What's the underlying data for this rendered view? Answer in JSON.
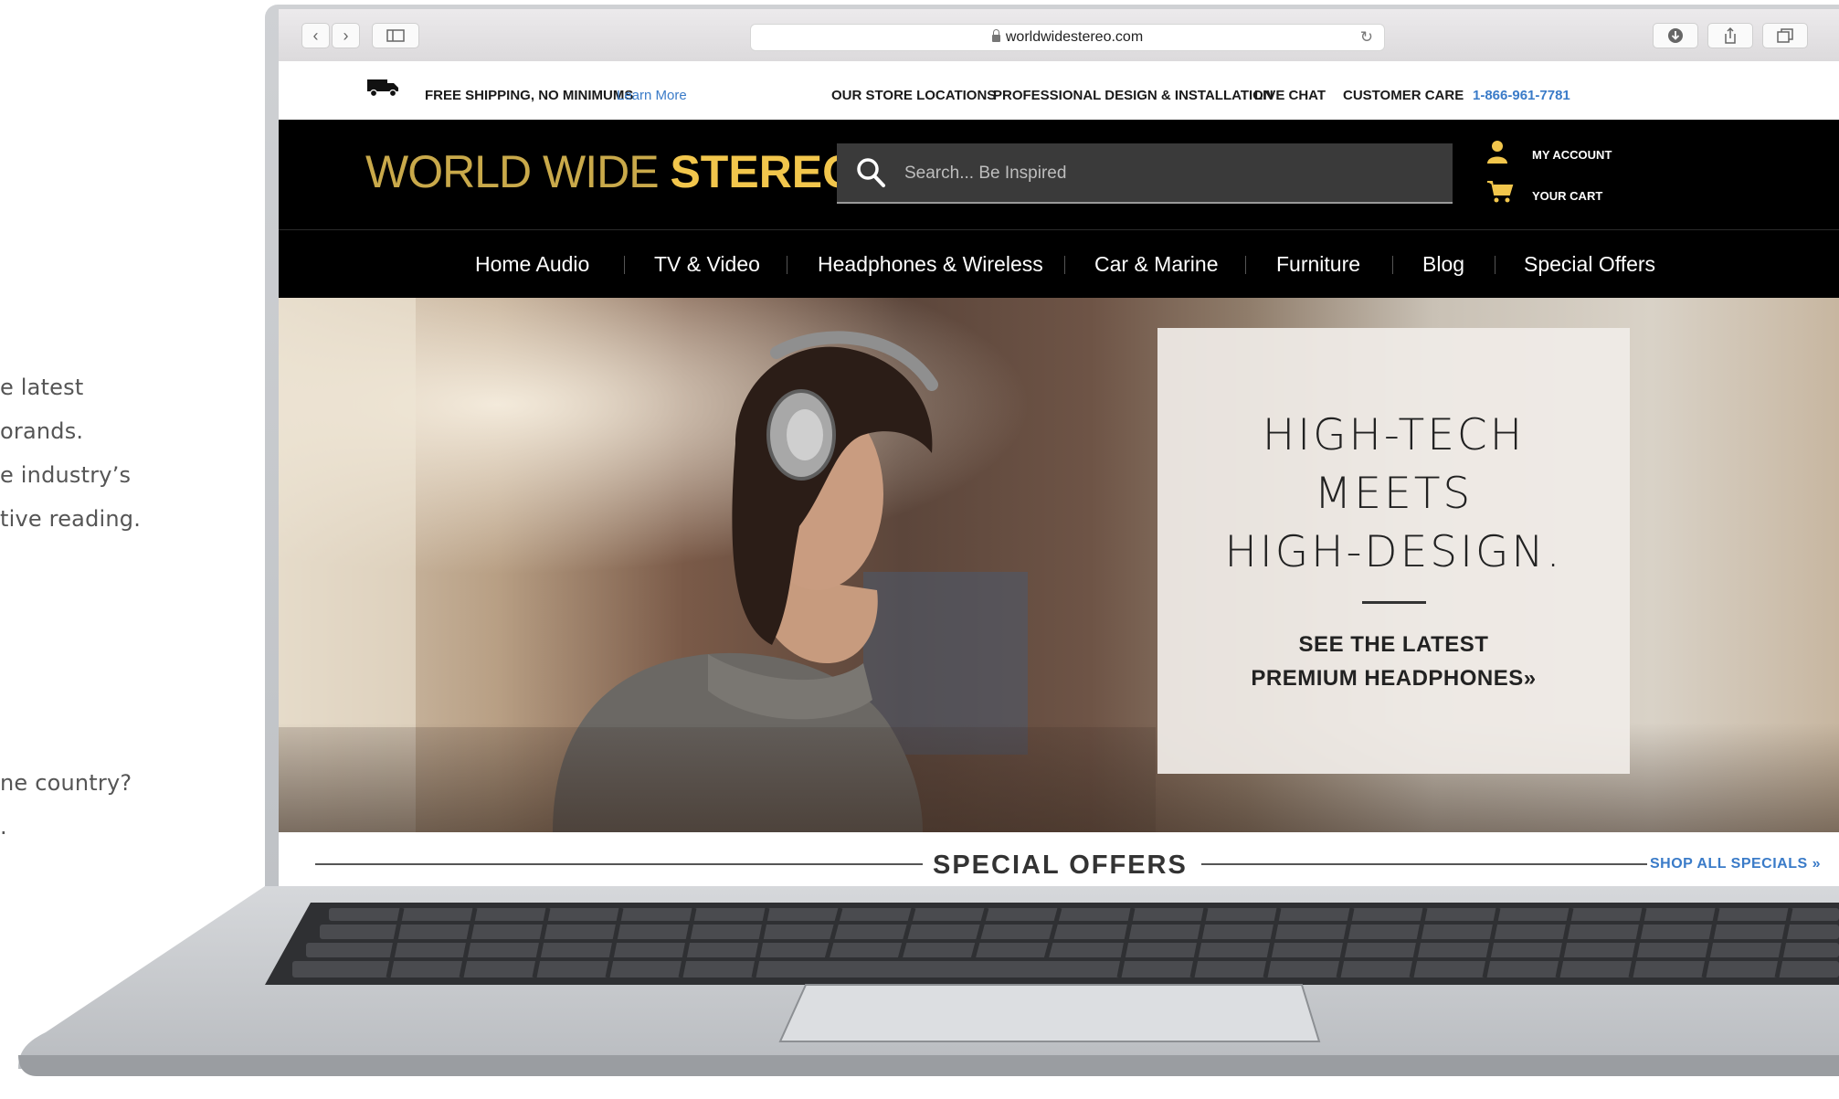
{
  "side_copy": [
    "e latest",
    "orands.",
    "e industry’s",
    "tive reading.",
    "ne country?",
    "."
  ],
  "browser": {
    "url": "worldwidestereo.com"
  },
  "utility_bar": {
    "shipping": "FREE SHIPPING, NO MINIMUMS",
    "learn_more": "Learn More",
    "links": [
      "OUR STORE LOCATIONS",
      "PROFESSIONAL DESIGN & INSTALLATION",
      "LIVE CHAT",
      "CUSTOMER CARE"
    ],
    "phone": "1-866-961-7781"
  },
  "header": {
    "logo_light": "WORLD WIDE",
    "logo_bold": "STEREO",
    "search_placeholder": "Search... Be Inspired",
    "my_account": "MY ACCOUNT",
    "your_cart": "YOUR CART"
  },
  "nav": {
    "items": [
      "Home Audio",
      "TV & Video",
      "Headphones & Wireless",
      "Car & Marine",
      "Furniture",
      "Blog",
      "Special Offers"
    ]
  },
  "hero": {
    "headline_lines": [
      "HIGH-TECH",
      "MEETS",
      "HIGH-DESIGN."
    ],
    "cta_lines": [
      "SEE THE LATEST",
      "PREMIUM HEADPHONES»"
    ]
  },
  "special_offers": {
    "title": "SPECIAL OFFERS",
    "shop_all": "SHOP ALL SPECIALS »"
  },
  "colors": {
    "brand_gold": "#f2c64c",
    "link_blue": "#3a7bc8",
    "header_bg": "#000000"
  }
}
